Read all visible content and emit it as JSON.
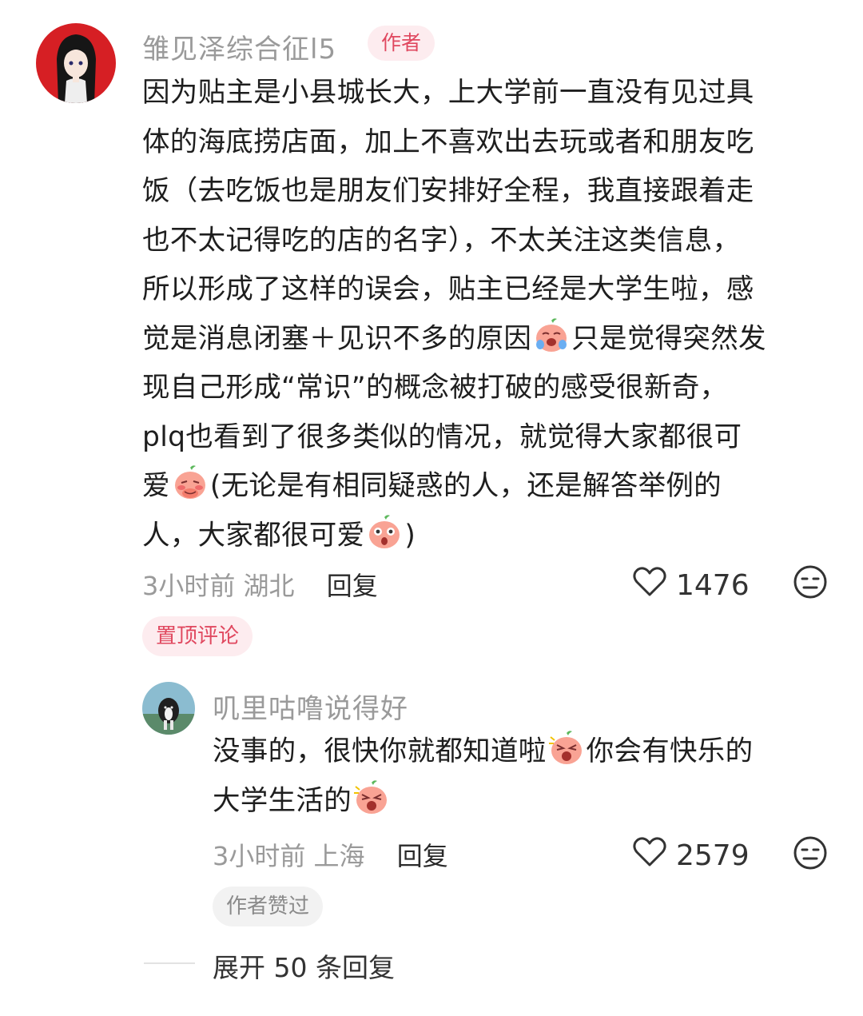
{
  "comment": {
    "username": "雏见泽综合征l5",
    "author_tag": "作者",
    "text_lines": [
      "因为贴主是小县城长大，上大学前一直没有见过具",
      "体的海底捞店面，加上不喜欢出去玩或者和朋友吃",
      "饭（去吃饭也是朋友们安排好全程，我直接跟着走",
      "也不太记得吃的店的名字），不太关注这类信息，",
      "所以形成了这样的误会，贴主已经是大学生啦，感",
      "觉是消息闭塞＋见识不多的原因",
      "只是觉得突然发",
      "现自己形成“常识”的概念被打破的感受很新奇，",
      "plq也看到了很多类似的情况，就觉得大家都很可",
      "爱",
      "(无论是有相同疑惑的人，还是解答举例的",
      "人，大家都很可爱",
      ")"
    ],
    "time": "3小时前",
    "location": "湖北",
    "reply_label": "回复",
    "likes": "1476",
    "pinned_label": "置顶评论"
  },
  "reply": {
    "username": "叽里咕噜说得好",
    "text_lines": [
      "没事的，很快你就都知道啦",
      "你会有快乐的",
      "大学生活的"
    ],
    "time": "3小时前",
    "location": "上海",
    "reply_label": "回复",
    "likes": "2579",
    "author_liked_label": "作者赞过"
  },
  "expand_label": "展开 50 条回复",
  "icons": {
    "like": "heart-outline-icon",
    "reaction": "neutral-face-icon",
    "emoji_1": "crying-face-emoji",
    "emoji_2": "shy-face-emoji",
    "emoji_3": "surprised-face-emoji",
    "emoji_4": "shouting-face-emoji",
    "emoji_5": "shouting-face-emoji"
  },
  "colors": {
    "accent": "#e0485f",
    "tag_bg": "#fdecef",
    "secondary_text": "#9a9a9a"
  }
}
